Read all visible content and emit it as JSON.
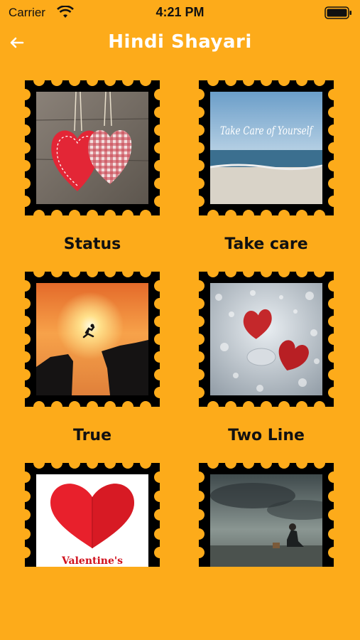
{
  "status_bar": {
    "carrier": "Carrier",
    "time": "4:21 PM"
  },
  "nav": {
    "title": "Hindi Shayari",
    "back_icon": "arrow-left-icon"
  },
  "colors": {
    "background": "#FDAB1A",
    "title": "#FFFFFF",
    "stamp_frame": "#000000"
  },
  "categories": [
    {
      "label": "Status",
      "image": "two-fabric-hearts"
    },
    {
      "label": "Take care",
      "image": "beach-take-care",
      "image_text": "Take Care of Yourself"
    },
    {
      "label": "True",
      "image": "sunset-jump"
    },
    {
      "label": "Two Line",
      "image": "glass-hearts-raindrops"
    },
    {
      "label": "",
      "image": "red-paper-heart",
      "image_text": "Valentine's"
    },
    {
      "label": "",
      "image": "man-sitting-stormy-sky"
    }
  ]
}
